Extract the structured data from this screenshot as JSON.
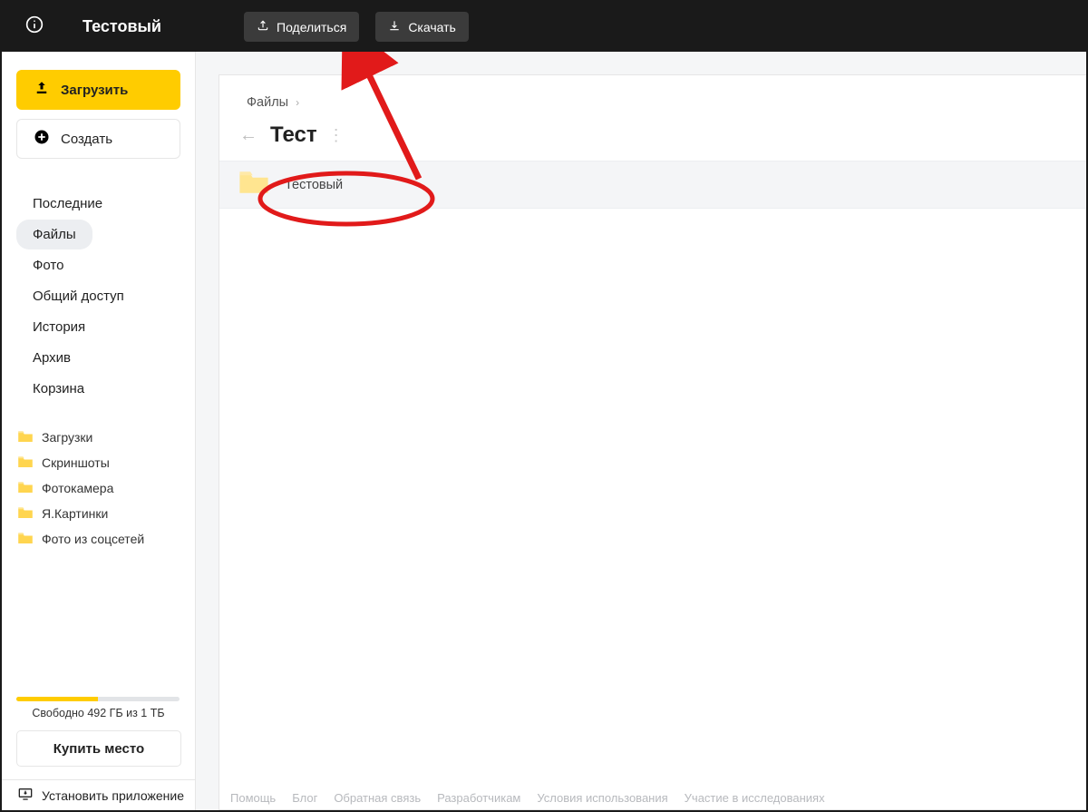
{
  "topbar": {
    "title": "Тестовый",
    "share_label": "Поделиться",
    "download_label": "Скачать"
  },
  "sidebar": {
    "upload_label": "Загрузить",
    "create_label": "Создать",
    "nav": [
      {
        "label": "Последние"
      },
      {
        "label": "Файлы",
        "active": true
      },
      {
        "label": "Фото"
      },
      {
        "label": "Общий доступ"
      },
      {
        "label": "История"
      },
      {
        "label": "Архив"
      },
      {
        "label": "Корзина"
      }
    ],
    "folders": [
      {
        "label": "Загрузки"
      },
      {
        "label": "Скриншоты"
      },
      {
        "label": "Фотокамера"
      },
      {
        "label": "Я.Картинки"
      },
      {
        "label": "Фото из соцсетей"
      }
    ],
    "storage_text": "Свободно 492 ГБ из 1 ТБ",
    "storage_fill_percent": 50,
    "buy_label": "Купить место",
    "install_label": "Установить приложение"
  },
  "main": {
    "breadcrumb_root": "Файлы",
    "folder_title": "Тест",
    "items": [
      {
        "name": "Тестовый"
      }
    ]
  },
  "footer": [
    "Помощь",
    "Блог",
    "Обратная связь",
    "Разработчикам",
    "Условия использования",
    "Участие в исследованиях"
  ],
  "colors": {
    "accent": "#ffcc00",
    "annotation": "#e11a1a"
  }
}
